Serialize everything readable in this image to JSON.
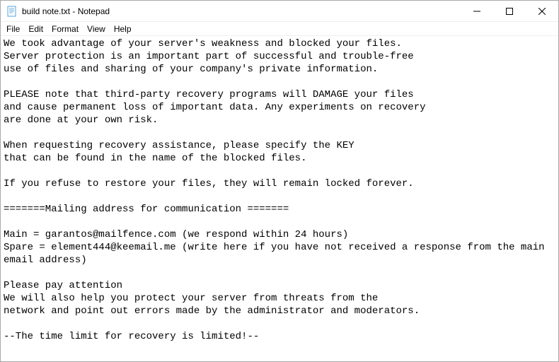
{
  "window": {
    "title": "build note.txt - Notepad"
  },
  "controls": {
    "minimize": "—",
    "maximize": "☐",
    "close": "✕"
  },
  "menu": {
    "file": "File",
    "edit": "Edit",
    "format": "Format",
    "view": "View",
    "help": "Help"
  },
  "document": {
    "body": "We took advantage of your server's weakness and blocked your files.\nServer protection is an important part of successful and trouble-free\nuse of files and sharing of your company's private information.\n\nPLEASE note that third-party recovery programs will DAMAGE your files\nand cause permanent loss of important data. Any experiments on recovery\nare done at your own risk.\n\nWhen requesting recovery assistance, please specify the KEY\nthat can be found in the name of the blocked files.\n\nIf you refuse to restore your files, they will remain locked forever.\n\n=======Mailing address for communication =======\n\nMain = garantos@mailfence.com (we respond within 24 hours)\nSpare = element444@keemail.me (write here if you have not received a response from the main email address)\n\nPlease pay attention\nWe will also help you protect your server from threats from the\nnetwork and point out errors made by the administrator and moderators.\n\n--The time limit for recovery is limited!--"
  }
}
